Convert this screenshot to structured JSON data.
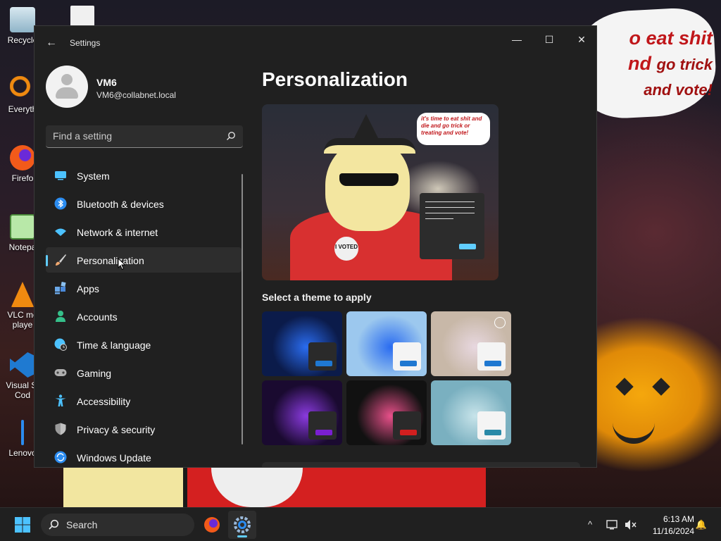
{
  "desktop": {
    "wallpaper_text": [
      "o eat shit",
      "nd",
      "go trick",
      "and vote!"
    ],
    "icons": [
      {
        "label": "Recycle",
        "icon": "recycle-bin-icon"
      },
      {
        "label": "Everyth",
        "icon": "everything-search-icon"
      },
      {
        "label": "Firefo",
        "icon": "firefox-icon"
      },
      {
        "label": "Notepa",
        "icon": "notepad-icon"
      },
      {
        "label": "VLC me\nplaye",
        "icon": "vlc-icon"
      },
      {
        "label": "Visual St\nCod",
        "icon": "vscode-icon"
      },
      {
        "label": "Lenovo",
        "icon": "lenovo-icon"
      }
    ]
  },
  "window": {
    "title": "Settings",
    "controls": {
      "minimize": "—",
      "maximize": "☐",
      "close": "✕"
    }
  },
  "profile": {
    "name": "VM6",
    "email": "VM6@collabnet.local"
  },
  "search": {
    "placeholder": "Find a setting"
  },
  "nav": {
    "active": "Personalization",
    "items": [
      {
        "label": "System",
        "icon": "system-icon",
        "color": "#4cc2ff"
      },
      {
        "label": "Bluetooth & devices",
        "icon": "bluetooth-icon",
        "color": "#2b8cf0"
      },
      {
        "label": "Network & internet",
        "icon": "wifi-icon",
        "color": "#4cc2ff"
      },
      {
        "label": "Personalization",
        "icon": "brush-icon",
        "color": "#f0a870"
      },
      {
        "label": "Apps",
        "icon": "apps-icon",
        "color": "#6aa8e8"
      },
      {
        "label": "Accounts",
        "icon": "accounts-icon",
        "color": "#35c08a"
      },
      {
        "label": "Time & language",
        "icon": "time-language-icon",
        "color": "#4cc2ff"
      },
      {
        "label": "Gaming",
        "icon": "gaming-icon",
        "color": "#b0b0b0"
      },
      {
        "label": "Accessibility",
        "icon": "accessibility-icon",
        "color": "#4cc2ff"
      },
      {
        "label": "Privacy & security",
        "icon": "shield-icon",
        "color": "#9a9a9a"
      },
      {
        "label": "Windows Update",
        "icon": "windows-update-icon",
        "color": "#2b8cf0"
      }
    ]
  },
  "main": {
    "title": "Personalization",
    "preview": {
      "speech": "it's time to eat shit and die and go trick or treating and vote!",
      "badge": "I VOTED"
    },
    "themes_label": "Select a theme to apply",
    "themes": [
      {
        "name": "windows-dark",
        "bg": "#0b1b4a",
        "bloom": "#2a6cf0",
        "mini": "#2a2a2a",
        "accent": "#1f78d1"
      },
      {
        "name": "windows-light",
        "bg": "#9cc8ee",
        "bloom": "#2a6cf0",
        "mini": "#f4f4f4",
        "accent": "#1f78d1"
      },
      {
        "name": "windows-spotlight",
        "bg": "#c8b8a8",
        "bloom": "#e8d8e0",
        "mini": "#f4f4f4",
        "accent": "#1f78d1"
      },
      {
        "name": "glow",
        "bg": "#1a0a30",
        "bloom": "#8a3adf",
        "mini": "#2a2a2a",
        "accent": "#7a1fd1"
      },
      {
        "name": "captured-motion",
        "bg": "#111111",
        "bloom": "#e8508a",
        "mini": "#2a2a2a",
        "accent": "#d11f1f"
      },
      {
        "name": "flow",
        "bg": "#7ab0c0",
        "bloom": "#c8e4ea",
        "mini": "#f4f4f4",
        "accent": "#2a8aa8"
      }
    ]
  },
  "taskbar": {
    "search_label": "Search",
    "time": "6:13 AM",
    "date": "11/16/2024",
    "tray": {
      "chevron": "^",
      "notification": "🔔"
    }
  }
}
